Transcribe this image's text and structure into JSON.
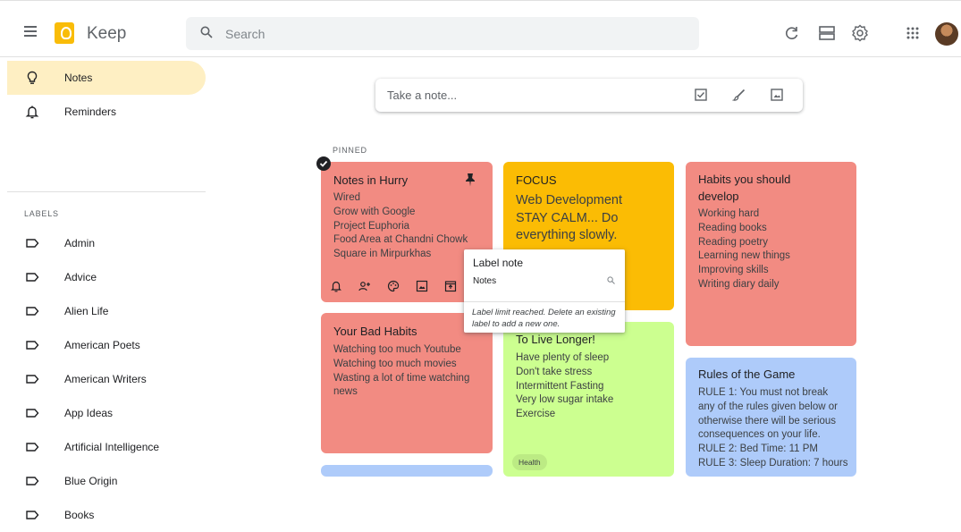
{
  "header": {
    "app_title": "Keep",
    "search_placeholder": "Search",
    "icons": [
      "menu-icon",
      "keep-logo",
      "search-icon",
      "refresh-icon",
      "list-view-icon",
      "settings-icon",
      "apps-grid-icon",
      "avatar"
    ]
  },
  "sidebar": {
    "items": [
      {
        "label": "Notes",
        "icon": "lightbulb-icon",
        "active": true
      },
      {
        "label": "Reminders",
        "icon": "bell-icon"
      }
    ],
    "labels_heading": "LABELS",
    "labels": [
      "Admin",
      "Advice",
      "Alien Life",
      "American Poets",
      "American Writers",
      "App Ideas",
      "Artificial Intelligence",
      "Blue Origin",
      "Books"
    ]
  },
  "take_note": {
    "placeholder": "Take a note...",
    "icons": [
      "checkbox-icon",
      "brush-icon",
      "image-icon"
    ]
  },
  "pinned_heading": "PINNED",
  "notes": {
    "hurry": {
      "title": "Notes in Hurry",
      "body": "Wired\nGrow with Google\nProject Euphoria\nFood Area at Chandni Chowk\nSquare in Mirpurkhas",
      "color": "#f28b82"
    },
    "focus": {
      "title": "FOCUS",
      "body": "Web Development\nSTAY CALM... Do\neverything slowly.",
      "color": "#fbbc04"
    },
    "habits": {
      "title": "Habits you should\ndevelop",
      "body": "Working hard\nReading books\nReading poetry\nLearning new things\nImproving skills\nWriting diary daily",
      "color": "#f28b82"
    },
    "bad_habits": {
      "title": "Your Bad Habits",
      "body": "Watching too much Youtube\nWatching too much movies\nWasting a lot of time watching\nnews",
      "color": "#f28b82"
    },
    "longer": {
      "title": "To Live Longer!",
      "body": "Have plenty of sleep\nDon't take stress\nIntermittent Fasting\nVery low sugar intake\nExercise",
      "chip": "Health",
      "color": "#ccff90"
    },
    "rules": {
      "title": "Rules of the Game",
      "body": "RULE 1: You must not break\nany of the rules given below or\notherwise there will be serious\nconsequences on your life.\nRULE 2: Bed Time: 11 PM\nRULE 3: Sleep Duration: 7 hours",
      "color": "#aecbfa"
    }
  },
  "label_popup": {
    "title": "Label note",
    "input_value": "Notes",
    "message": "Label limit reached. Delete an existing label to add a new one."
  }
}
